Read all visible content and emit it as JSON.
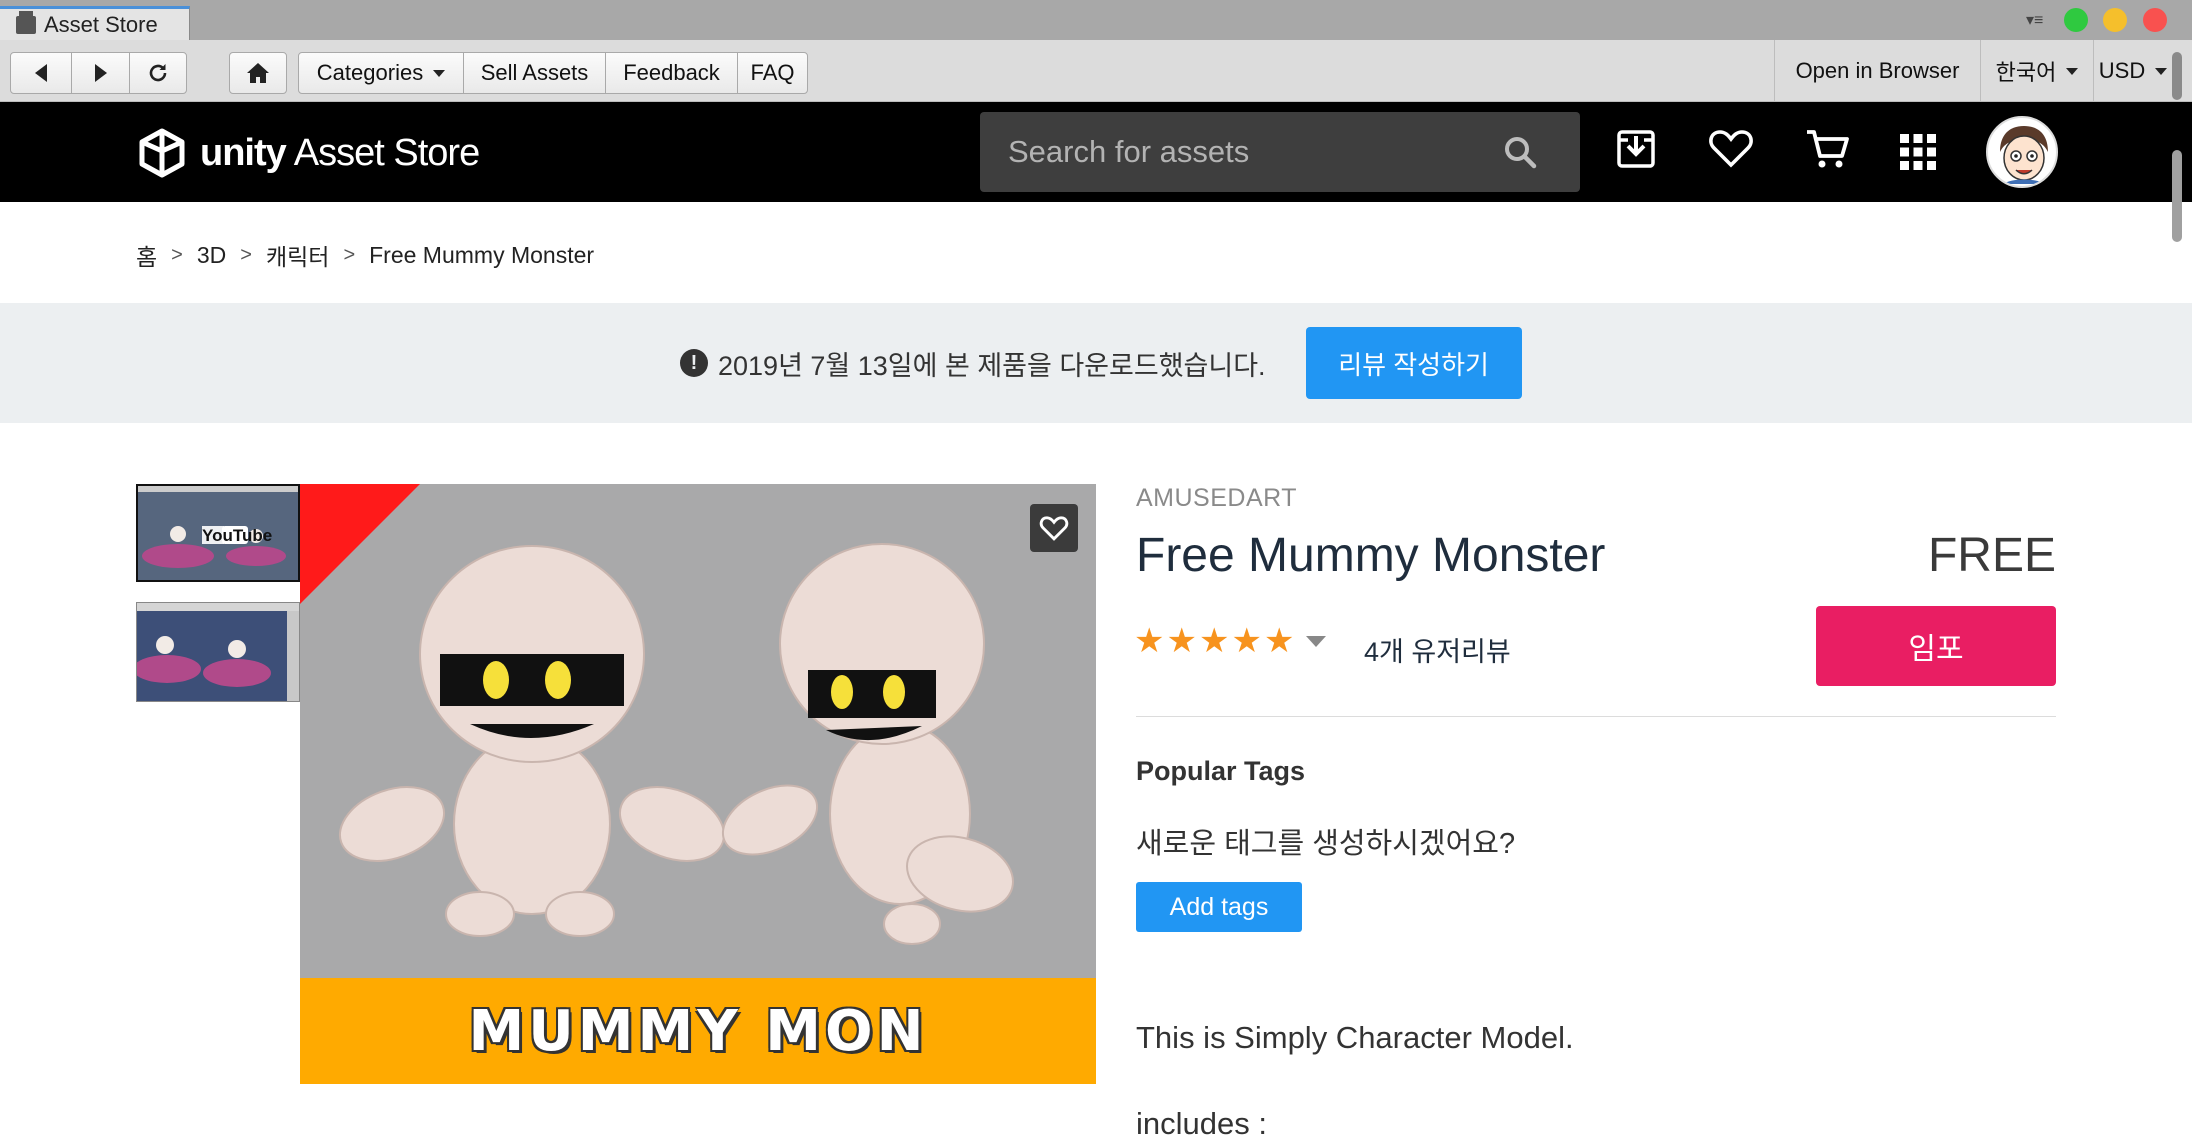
{
  "window": {
    "tab_title": "Asset Store",
    "traffic_colors": {
      "green": "#2fc940",
      "yellow": "#f5bf2c",
      "red": "#f9514f"
    }
  },
  "toolbar": {
    "categories_label": "Categories",
    "sell_label": "Sell Assets",
    "feedback_label": "Feedback",
    "faq_label": "FAQ",
    "open_browser_label": "Open in Browser",
    "language_label": "한국어",
    "currency_label": "USD"
  },
  "header": {
    "logo_unity": "unity",
    "logo_store": "Asset Store",
    "search_placeholder": "Search for assets",
    "icons": [
      "download-icon",
      "heart-icon",
      "cart-icon",
      "apps-grid-icon"
    ]
  },
  "breadcrumb": {
    "items": [
      "홈",
      "3D",
      "캐릭터",
      "Free Mummy Monster"
    ],
    "separator": ">"
  },
  "notice": {
    "message": "2019년 7월 13일에 본 제품을 다운로드했습니다.",
    "button_label": "리뷰 작성하기"
  },
  "gallery": {
    "thumbnail_1_text": "YouTube",
    "banner_text": "MUMMY MON"
  },
  "product": {
    "publisher": "AMUSEDART",
    "title": "Free Mummy Monster",
    "price": "FREE",
    "rating": 5,
    "rating_max": 5,
    "review_count_label": "4개 유저리뷰",
    "import_label": "임포",
    "tags_heading": "Popular Tags",
    "tags_prompt": "새로운 태그를 생성하시겠어요?",
    "add_tags_label": "Add tags",
    "description_line_1": "This is Simply Character Model.",
    "description_line_2": "includes :"
  },
  "colors": {
    "accent_blue": "#2196f3",
    "import_pink": "#e91e63",
    "star_orange": "#f7931e",
    "banner_orange": "#ffaa00"
  }
}
